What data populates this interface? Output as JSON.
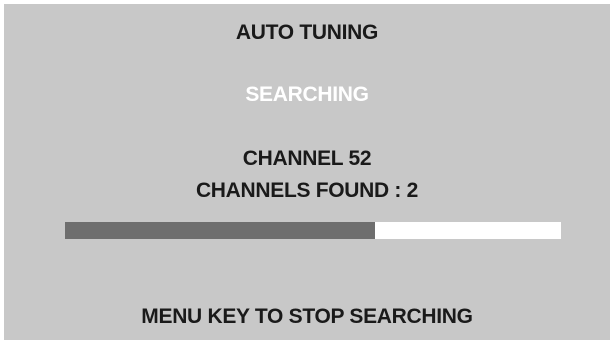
{
  "menu": {
    "title": "AUTO TUNING",
    "status": "SEARCHING",
    "channel": "CHANNEL 52",
    "channels_found": "CHANNELS FOUND : 2",
    "progress_fraction": 0.625,
    "hint": "MENU KEY TO STOP SEARCHING"
  },
  "colors": {
    "background": "#c8c8c8",
    "text": "#1a1a1a",
    "status_text": "#ffffff",
    "progress_fill": "#6e6e6e",
    "progress_track": "#ffffff"
  }
}
